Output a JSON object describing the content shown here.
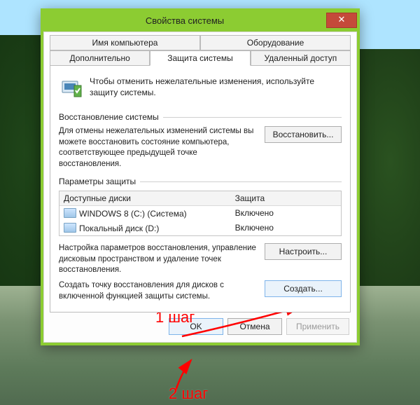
{
  "window": {
    "title": "Свойства системы",
    "close_label": "✕"
  },
  "tabs": {
    "computer_name": "Имя компьютера",
    "hardware": "Оборудование",
    "advanced": "Дополнительно",
    "system_protection": "Защита системы",
    "remote": "Удаленный доступ"
  },
  "intro": {
    "text": "Чтобы отменить нежелательные изменения, используйте защиту системы."
  },
  "restore": {
    "group_label": "Восстановление системы",
    "desc": "Для отмены нежелательных изменений системы вы можете восстановить состояние компьютера, соответствующее предыдущей точке восстановления.",
    "button": "Восстановить..."
  },
  "protection": {
    "group_label": "Параметры защиты",
    "col_drives": "Доступные диски",
    "col_status": "Защита",
    "rows": [
      {
        "name": "WINDOWS 8 (C:) (Система)",
        "status": "Включено"
      },
      {
        "name": "Покальный диск (D:)",
        "status": "Включено"
      }
    ],
    "config_desc": "Настройка параметров восстановления, управление дисковым пространством и удаление точек восстановления.",
    "config_button": "Настроить...",
    "create_desc": "Создать точку восстановления для дисков с включенной функцией защиты системы.",
    "create_button": "Создать..."
  },
  "footer": {
    "ok": "OK",
    "cancel": "Отмена",
    "apply": "Применить"
  },
  "annotations": {
    "step1": "1 шаг",
    "step2": "2 шаг"
  }
}
